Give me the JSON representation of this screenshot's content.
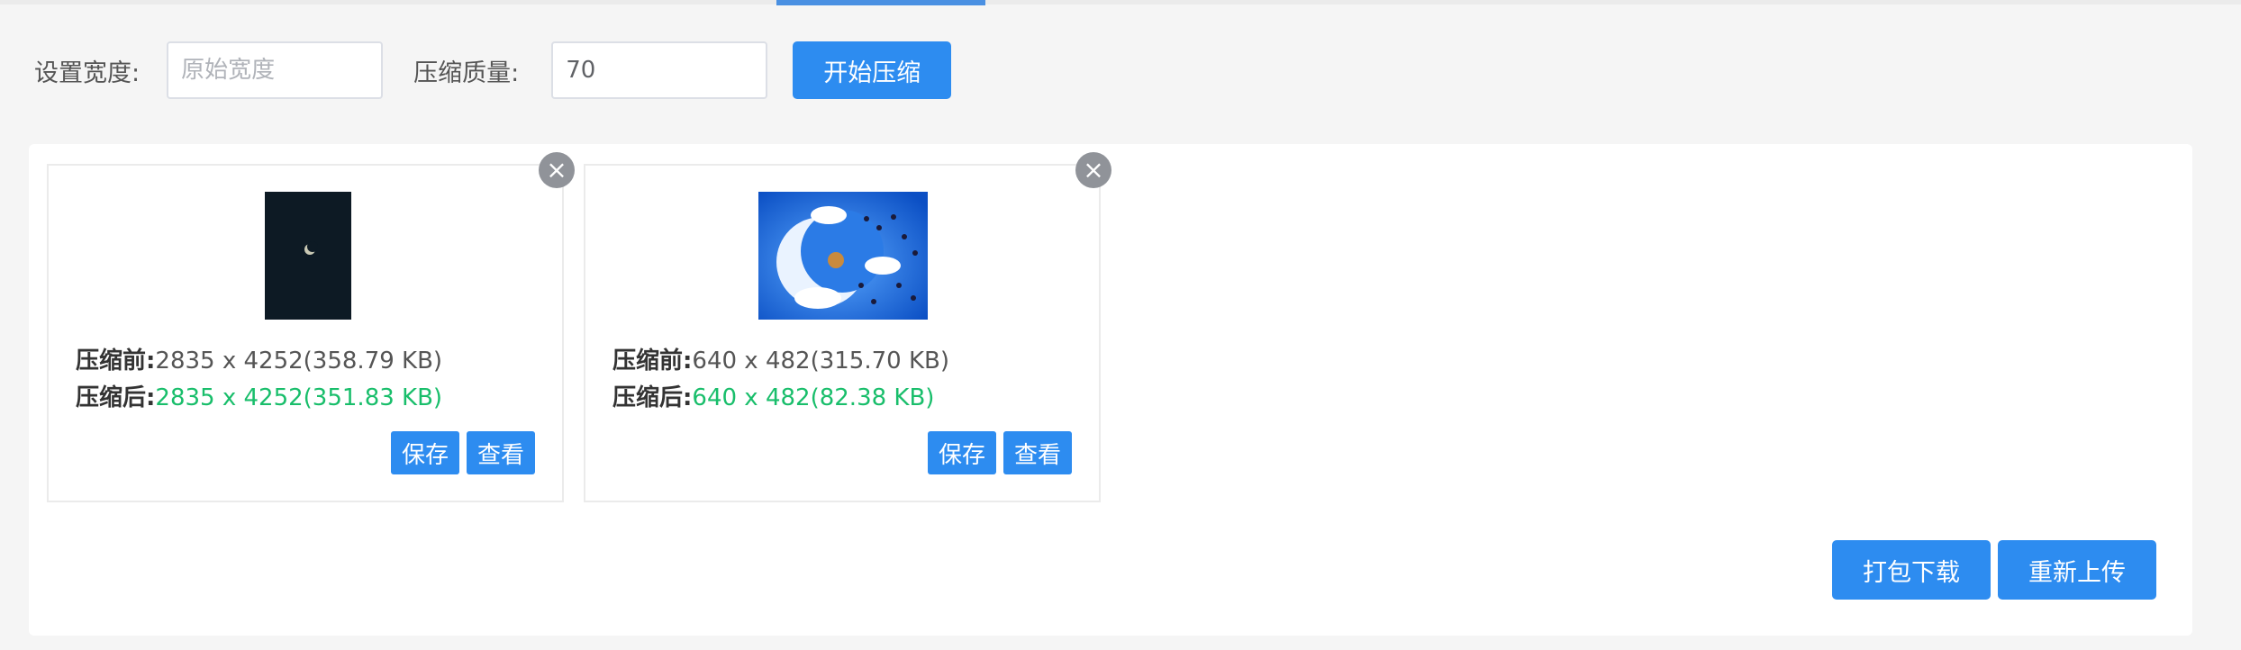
{
  "toolbar": {
    "width_label": "设置宽度:",
    "width_placeholder": "原始宽度",
    "width_value": "",
    "quality_label": "压缩质量:",
    "quality_value": "70",
    "start_label": "开始压缩"
  },
  "images": [
    {
      "before_label": "压缩前:",
      "before_value": "2835 x 4252(358.79 KB)",
      "after_label": "压缩后:",
      "after_value": "2835 x 4252(351.83 KB)",
      "save_label": "保存",
      "view_label": "查看"
    },
    {
      "before_label": "压缩前:",
      "before_value": "640 x 482(315.70 KB)",
      "after_label": "压缩后:",
      "after_value": "640 x 482(82.38 KB)",
      "save_label": "保存",
      "view_label": "查看"
    }
  ],
  "footer": {
    "download_label": "打包下载",
    "reupload_label": "重新上传"
  },
  "icons": {
    "close": "close-icon"
  },
  "colors": {
    "primary": "#2d8cf0",
    "success": "#19be6b",
    "close_bg": "#909399"
  }
}
